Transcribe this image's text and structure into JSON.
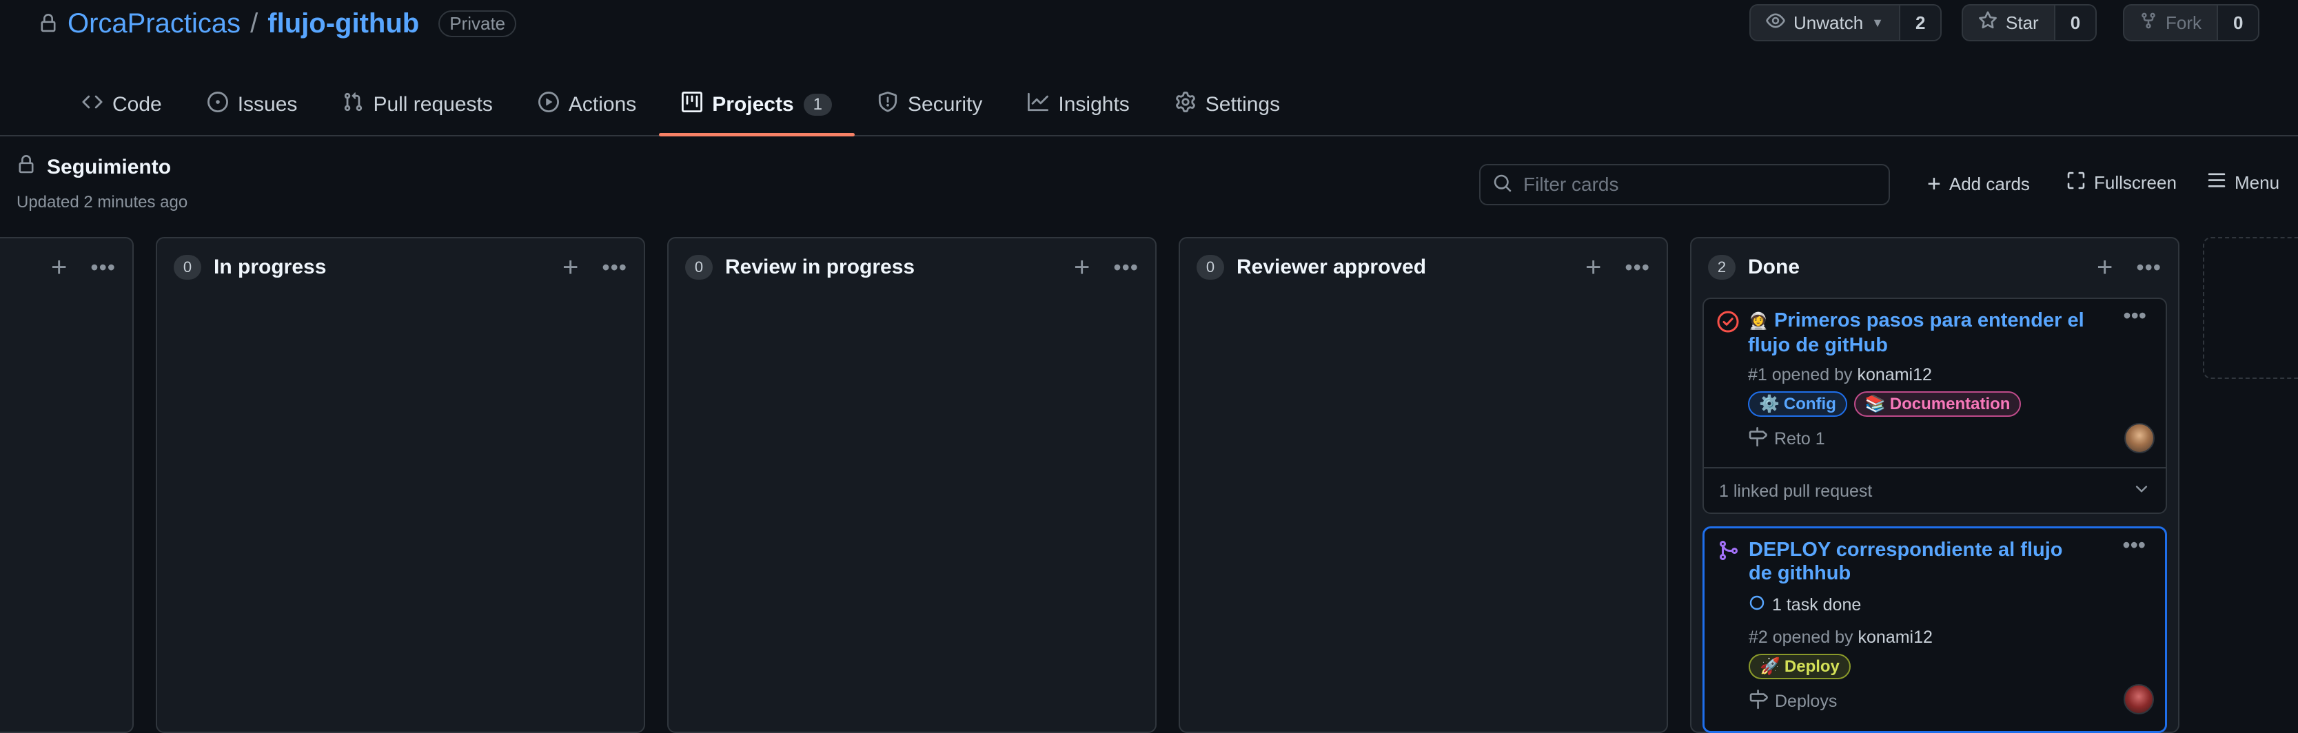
{
  "repo": {
    "owner": "OrcaPracticas",
    "separator": "/",
    "name": "flujo-github",
    "visibility": "Private"
  },
  "repo_actions": {
    "watch": {
      "label": "Unwatch",
      "count": "2"
    },
    "star": {
      "label": "Star",
      "count": "0"
    },
    "fork": {
      "label": "Fork",
      "count": "0"
    }
  },
  "tabs": [
    {
      "label": "Code"
    },
    {
      "label": "Issues"
    },
    {
      "label": "Pull requests"
    },
    {
      "label": "Actions"
    },
    {
      "label": "Projects",
      "count": "1",
      "active": true
    },
    {
      "label": "Security"
    },
    {
      "label": "Insights"
    },
    {
      "label": "Settings"
    }
  ],
  "project": {
    "name": "Seguimiento",
    "updated": "Updated 2 minutes ago",
    "filter_placeholder": "Filter cards",
    "add_cards": "Add cards",
    "fullscreen": "Fullscreen",
    "menu": "Menu"
  },
  "columns": [
    {
      "count": "0",
      "title": "In progress"
    },
    {
      "count": "0",
      "title": "Review in progress"
    },
    {
      "count": "0",
      "title": "Reviewer approved"
    },
    {
      "count": "2",
      "title": "Done"
    }
  ],
  "cards": [
    {
      "emoji": "👩‍🚀",
      "title": "Primeros pasos para entender el flujo de gitHub",
      "meta_prefix": "#1 opened by",
      "author": "konami12",
      "labels": [
        {
          "text": "Config",
          "emoji": "⚙️",
          "color": "#58a6ff"
        },
        {
          "text": "Documentation",
          "emoji": "📚",
          "color": "#f778ba"
        }
      ],
      "milestone": "Reto 1",
      "linked": "1 linked pull request"
    },
    {
      "title": "DEPLOY correspondiente al flujo de githhub",
      "tasks": "1 task done",
      "meta_prefix": "#2 opened by",
      "author": "konami12",
      "labels": [
        {
          "text": "Deploy",
          "emoji": "🚀",
          "color": "#d4e157"
        }
      ],
      "milestone": "Deploys"
    }
  ],
  "colors": {
    "accent": "#58a6ff",
    "tab_underline": "#f78166",
    "bg": "#0d1117",
    "column_bg": "#161b22",
    "border": "#30363d"
  }
}
